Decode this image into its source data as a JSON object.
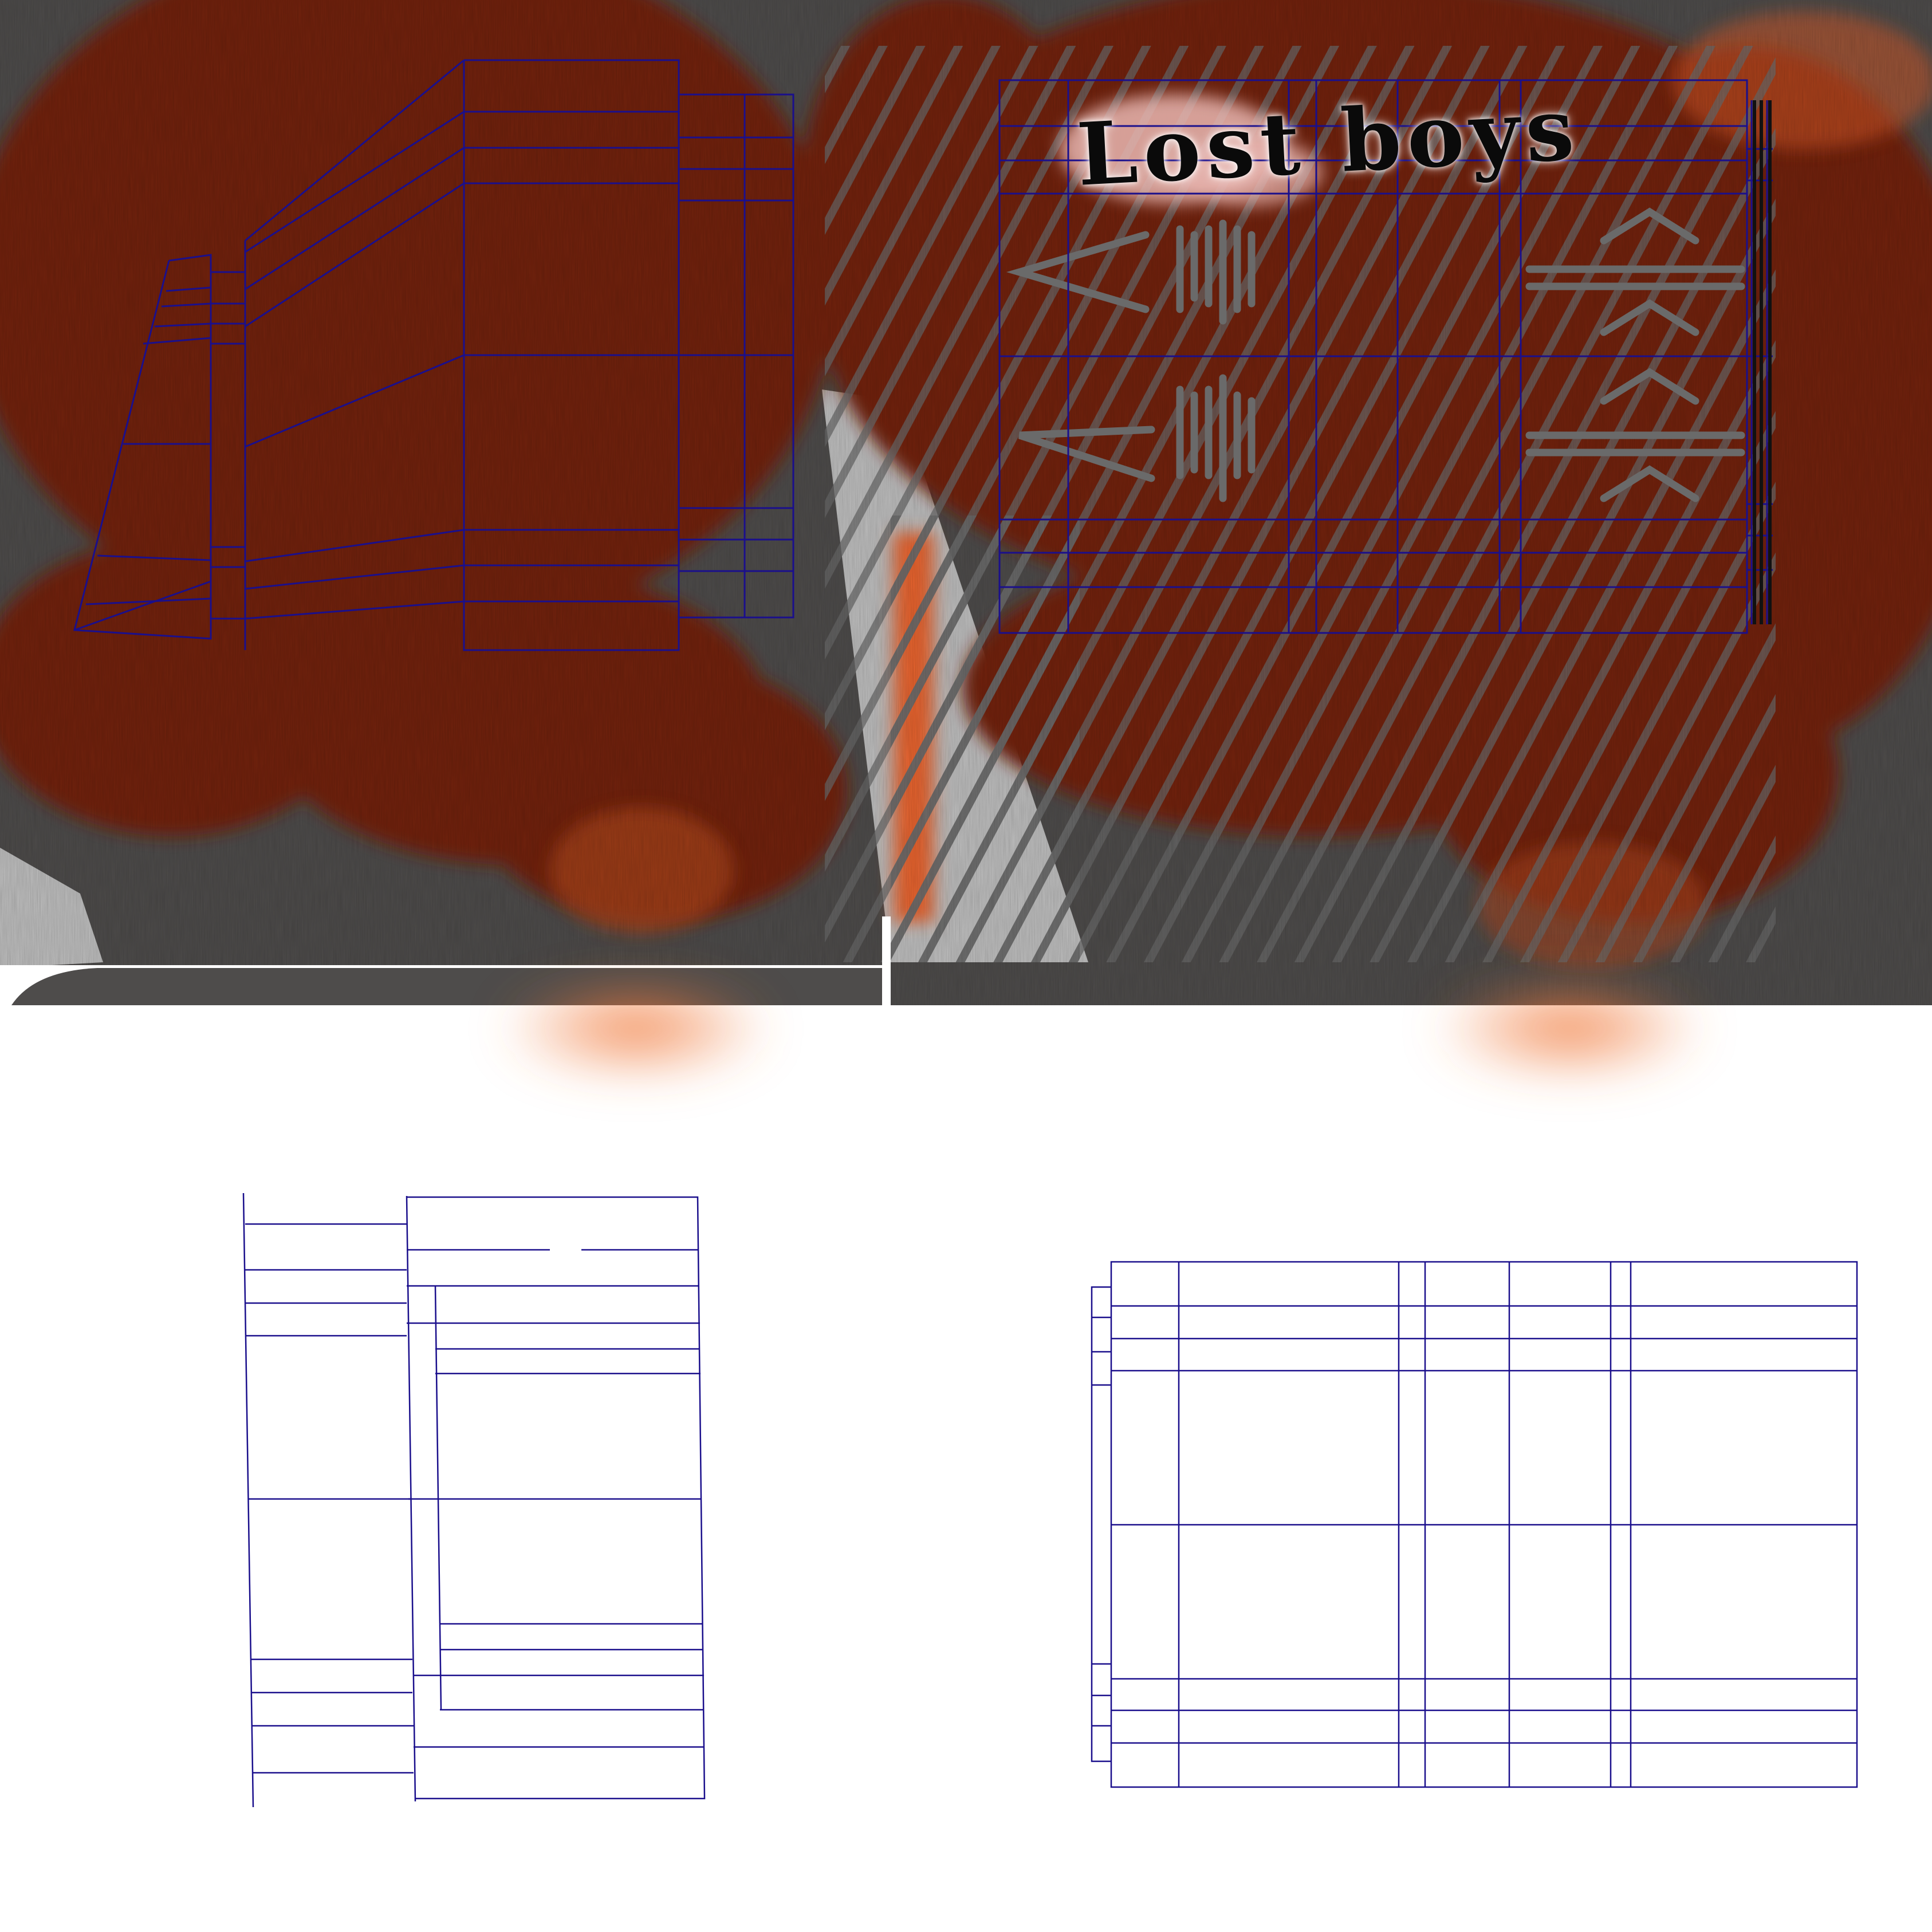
{
  "artwork": {
    "caption": "Lost boys",
    "colors": {
      "background": "#ffffff",
      "rust": "#722410",
      "orange_glow": "#e8642e",
      "grey": "#4e4c4b",
      "light_grey": "#bfbfbf",
      "hatch_grey": "#6a6a6a",
      "line_blue": "#1a0f8c",
      "blotch_pink": "#e9b6b0"
    }
  }
}
